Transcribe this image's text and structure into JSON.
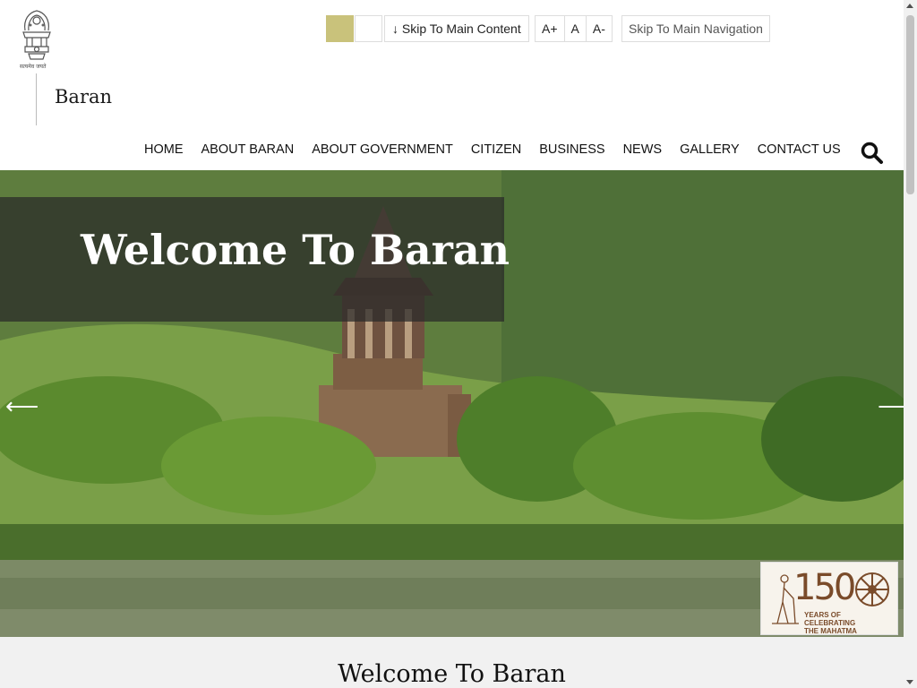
{
  "header": {
    "emblem_motto": "सत्यमेव जयते",
    "site_name": "Baran",
    "accessibility": {
      "contrast_swatches": [
        "#c9c27b",
        "#ffffff"
      ],
      "skip_main_content": "↓ Skip To Main Content",
      "font_increase": "A+",
      "font_normal": "A",
      "font_decrease": "A-",
      "skip_main_navigation": "Skip To Main Navigation"
    },
    "nav": [
      {
        "label": "HOME"
      },
      {
        "label": "ABOUT BARAN"
      },
      {
        "label": "ABOUT GOVERNMENT"
      },
      {
        "label": "CITIZEN"
      },
      {
        "label": "BUSINESS"
      },
      {
        "label": "NEWS"
      },
      {
        "label": "GALLERY"
      },
      {
        "label": "CONTACT US"
      }
    ],
    "search_icon": "search-icon"
  },
  "hero": {
    "caption": "Welcome To Baran",
    "prev_arrow": "⟵",
    "next_arrow": "⟶",
    "badge": {
      "number": "150",
      "line1": "YEARS OF",
      "line2": "CELEBRATING",
      "line3": "THE MAHATMA"
    }
  },
  "section": {
    "title": "Welcome To Baran"
  }
}
